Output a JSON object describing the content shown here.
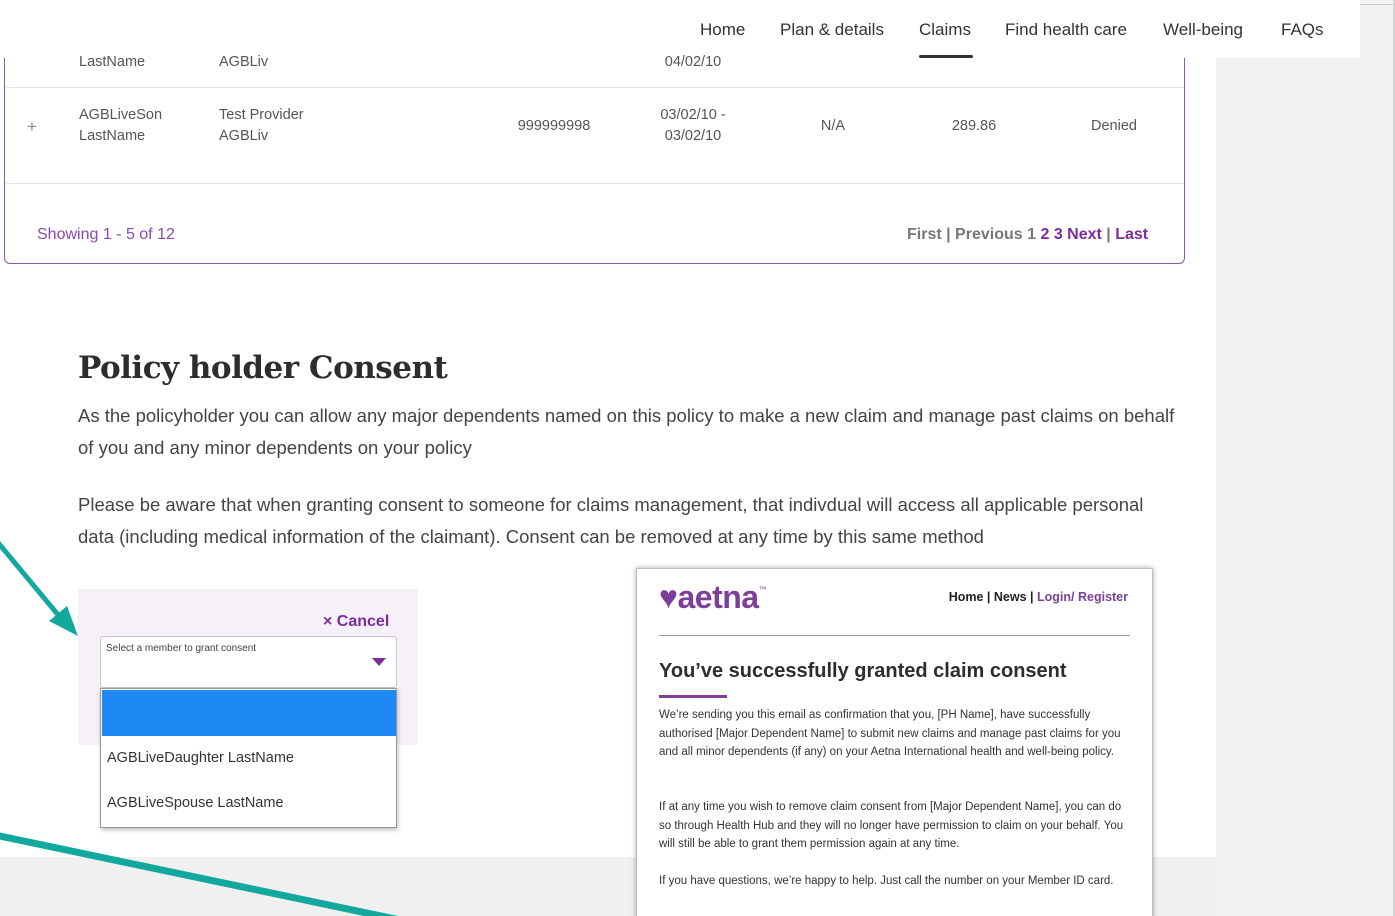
{
  "nav": {
    "items": [
      "Home",
      "Plan & details",
      "Claims",
      "Find health care",
      "Well-being",
      "FAQs"
    ],
    "active": "Claims"
  },
  "table": {
    "partial_row": {
      "member": "LastName",
      "provider": "AGBLiv",
      "date": "04/02/10"
    },
    "row": {
      "member_line1": "AGBLiveSon",
      "member_line2": "LastName",
      "provider_line1": "Test Provider",
      "provider_line2": "AGBLiv",
      "claim_number": "999999998",
      "date_line1": "03/02/10 -",
      "date_line2": "03/02/10",
      "na": "N/A",
      "amount": "289.86",
      "status": "Denied"
    },
    "expand_symbol": "+",
    "showing": "Showing 1 - 5 of 12",
    "pager": {
      "first": "First",
      "sep": " | ",
      "previous": "Previous",
      "page1": "1",
      "page2": "2",
      "page3": "3",
      "next": "Next",
      "last": "Last"
    }
  },
  "consent": {
    "title": "Policy holder Consent",
    "para1": "As the policyholder you can allow any major dependents named on this policy to make a new claim and manage past claims on behalf of you and any minor dependents on your policy",
    "para2": "Please be aware that when granting consent to someone for claims management, that indivdual will access all applicable personal data (including medical information of the claimant). Consent can be removed at any time by this same method",
    "cancel": "× Cancel",
    "select_label": "Select a member to grant consent",
    "options": [
      "",
      "AGBLiveDaughter LastName",
      "AGBLiveSpouse LastName"
    ]
  },
  "email": {
    "logo": "♥aetna",
    "tm": "™",
    "links": {
      "home": "Home",
      "news": "News",
      "login": "Login/ Register",
      "sep": " | "
    },
    "heading": "You’ve successfully granted claim consent",
    "para1": "We’re sending you this email as confirmation that you, [PH Name], have successfully authorised [Major Dependent Name] to submit new claims and manage past claims for you and all minor dependents (if any) on your Aetna International health and well-being policy.",
    "para2": "If at any time you wish to remove claim consent from [Major Dependent Name], you can do so through Health Hub and they will no longer have permission to claim on your behalf. You will still be able to grant them permission again at any time.",
    "para3": "If you have questions, we’re happy to help. Just call the number on your Member ID card."
  },
  "colors": {
    "brand_purple": "#7b2d9c",
    "annotation_teal": "#13a89e",
    "dropdown_highlight": "#1e88f5"
  }
}
